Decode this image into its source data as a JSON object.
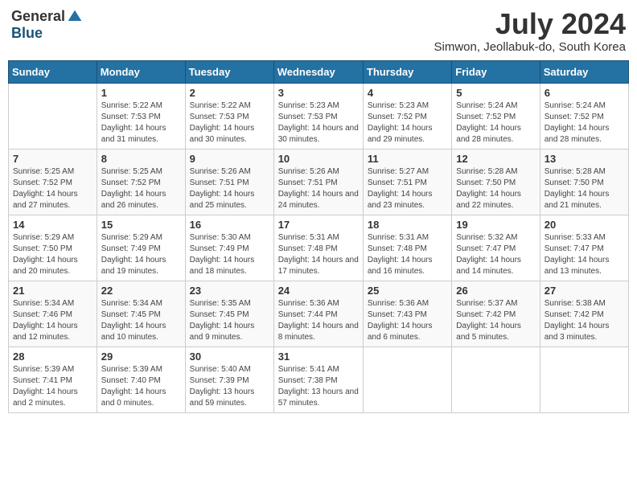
{
  "logo": {
    "general": "General",
    "blue": "Blue"
  },
  "title": "July 2024",
  "location": "Simwon, Jeollabuk-do, South Korea",
  "weekdays": [
    "Sunday",
    "Monday",
    "Tuesday",
    "Wednesday",
    "Thursday",
    "Friday",
    "Saturday"
  ],
  "weeks": [
    [
      {
        "day": "",
        "info": ""
      },
      {
        "day": "1",
        "info": "Sunrise: 5:22 AM\nSunset: 7:53 PM\nDaylight: 14 hours\nand 31 minutes."
      },
      {
        "day": "2",
        "info": "Sunrise: 5:22 AM\nSunset: 7:53 PM\nDaylight: 14 hours\nand 30 minutes."
      },
      {
        "day": "3",
        "info": "Sunrise: 5:23 AM\nSunset: 7:53 PM\nDaylight: 14 hours\nand 30 minutes."
      },
      {
        "day": "4",
        "info": "Sunrise: 5:23 AM\nSunset: 7:52 PM\nDaylight: 14 hours\nand 29 minutes."
      },
      {
        "day": "5",
        "info": "Sunrise: 5:24 AM\nSunset: 7:52 PM\nDaylight: 14 hours\nand 28 minutes."
      },
      {
        "day": "6",
        "info": "Sunrise: 5:24 AM\nSunset: 7:52 PM\nDaylight: 14 hours\nand 28 minutes."
      }
    ],
    [
      {
        "day": "7",
        "info": ""
      },
      {
        "day": "8",
        "info": "Sunrise: 5:25 AM\nSunset: 7:52 PM\nDaylight: 14 hours\nand 26 minutes."
      },
      {
        "day": "9",
        "info": "Sunrise: 5:26 AM\nSunset: 7:51 PM\nDaylight: 14 hours\nand 25 minutes."
      },
      {
        "day": "10",
        "info": "Sunrise: 5:26 AM\nSunset: 7:51 PM\nDaylight: 14 hours\nand 24 minutes."
      },
      {
        "day": "11",
        "info": "Sunrise: 5:27 AM\nSunset: 7:51 PM\nDaylight: 14 hours\nand 23 minutes."
      },
      {
        "day": "12",
        "info": "Sunrise: 5:28 AM\nSunset: 7:50 PM\nDaylight: 14 hours\nand 22 minutes."
      },
      {
        "day": "13",
        "info": "Sunrise: 5:28 AM\nSunset: 7:50 PM\nDaylight: 14 hours\nand 21 minutes."
      }
    ],
    [
      {
        "day": "14",
        "info": ""
      },
      {
        "day": "15",
        "info": "Sunrise: 5:29 AM\nSunset: 7:49 PM\nDaylight: 14 hours\nand 19 minutes."
      },
      {
        "day": "16",
        "info": "Sunrise: 5:30 AM\nSunset: 7:49 PM\nDaylight: 14 hours\nand 18 minutes."
      },
      {
        "day": "17",
        "info": "Sunrise: 5:31 AM\nSunset: 7:48 PM\nDaylight: 14 hours\nand 17 minutes."
      },
      {
        "day": "18",
        "info": "Sunrise: 5:31 AM\nSunset: 7:48 PM\nDaylight: 14 hours\nand 16 minutes."
      },
      {
        "day": "19",
        "info": "Sunrise: 5:32 AM\nSunset: 7:47 PM\nDaylight: 14 hours\nand 14 minutes."
      },
      {
        "day": "20",
        "info": "Sunrise: 5:33 AM\nSunset: 7:47 PM\nDaylight: 14 hours\nand 13 minutes."
      }
    ],
    [
      {
        "day": "21",
        "info": ""
      },
      {
        "day": "22",
        "info": "Sunrise: 5:34 AM\nSunset: 7:45 PM\nDaylight: 14 hours\nand 10 minutes."
      },
      {
        "day": "23",
        "info": "Sunrise: 5:35 AM\nSunset: 7:45 PM\nDaylight: 14 hours\nand 9 minutes."
      },
      {
        "day": "24",
        "info": "Sunrise: 5:36 AM\nSunset: 7:44 PM\nDaylight: 14 hours\nand 8 minutes."
      },
      {
        "day": "25",
        "info": "Sunrise: 5:36 AM\nSunset: 7:43 PM\nDaylight: 14 hours\nand 6 minutes."
      },
      {
        "day": "26",
        "info": "Sunrise: 5:37 AM\nSunset: 7:42 PM\nDaylight: 14 hours\nand 5 minutes."
      },
      {
        "day": "27",
        "info": "Sunrise: 5:38 AM\nSunset: 7:42 PM\nDaylight: 14 hours\nand 3 minutes."
      }
    ],
    [
      {
        "day": "28",
        "info": "Sunrise: 5:39 AM\nSunset: 7:41 PM\nDaylight: 14 hours\nand 2 minutes."
      },
      {
        "day": "29",
        "info": "Sunrise: 5:39 AM\nSunset: 7:40 PM\nDaylight: 14 hours\nand 0 minutes."
      },
      {
        "day": "30",
        "info": "Sunrise: 5:40 AM\nSunset: 7:39 PM\nDaylight: 13 hours\nand 59 minutes."
      },
      {
        "day": "31",
        "info": "Sunrise: 5:41 AM\nSunset: 7:38 PM\nDaylight: 13 hours\nand 57 minutes."
      },
      {
        "day": "",
        "info": ""
      },
      {
        "day": "",
        "info": ""
      },
      {
        "day": "",
        "info": ""
      }
    ]
  ],
  "week1_sunday": "Sunrise: 5:25 AM\nSunset: 7:52 PM\nDaylight: 14 hours\nand 27 minutes.",
  "week2_sunday": "Sunrise: 5:29 AM\nSunset: 7:50 PM\nDaylight: 14 hours\nand 20 minutes.",
  "week3_sunday": "Sunrise: 5:34 AM\nSunset: 7:46 PM\nDaylight: 14 hours\nand 12 minutes."
}
